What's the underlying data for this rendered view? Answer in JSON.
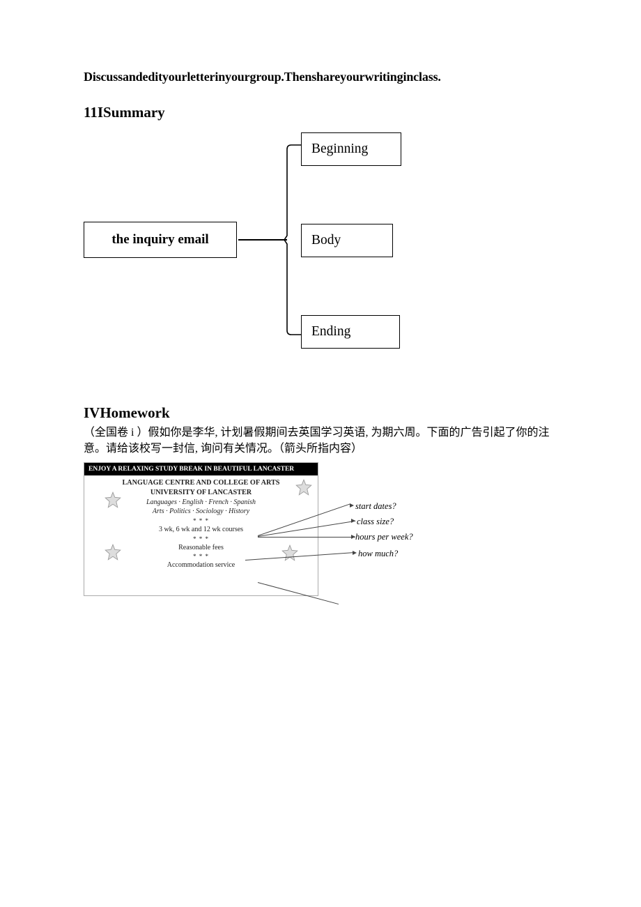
{
  "line1": "Discussandedityourletterinyourgroup.Thenshareyourwritinginclass.",
  "summary_heading": "11ISummary",
  "diagram": {
    "main": "the inquiry email",
    "sub1": "Beginning",
    "sub2": "Body",
    "sub3": "Ending"
  },
  "homework_heading": "IVHomework",
  "homework_text": "（全国卷 i ）假如你是李华, 计划暑假期间去英国学习英语, 为期六周。下面的广告引起了你的注意。请给该校写一封信, 询问有关情况。（箭头所指内容）",
  "ad": {
    "header": "ENJOY A RELAXING STUDY BREAK IN BEAUTIFUL LANCASTER",
    "inst1": "LANGUAGE CENTRE AND COLLEGE OF ARTS",
    "inst2": "UNIVERSITY OF LANCASTER",
    "langs": "Languages · English · French · Spanish",
    "arts": "Arts · Politics · Sociology · History",
    "dots": "* * *",
    "courses": "3 wk, 6 wk and 12 wk courses",
    "fees": "Reasonable fees",
    "accom": "Accommodation service"
  },
  "queries": {
    "q1": "start dates?",
    "q2": "class size?",
    "q3": "hours per week?",
    "q4": "how much?"
  }
}
